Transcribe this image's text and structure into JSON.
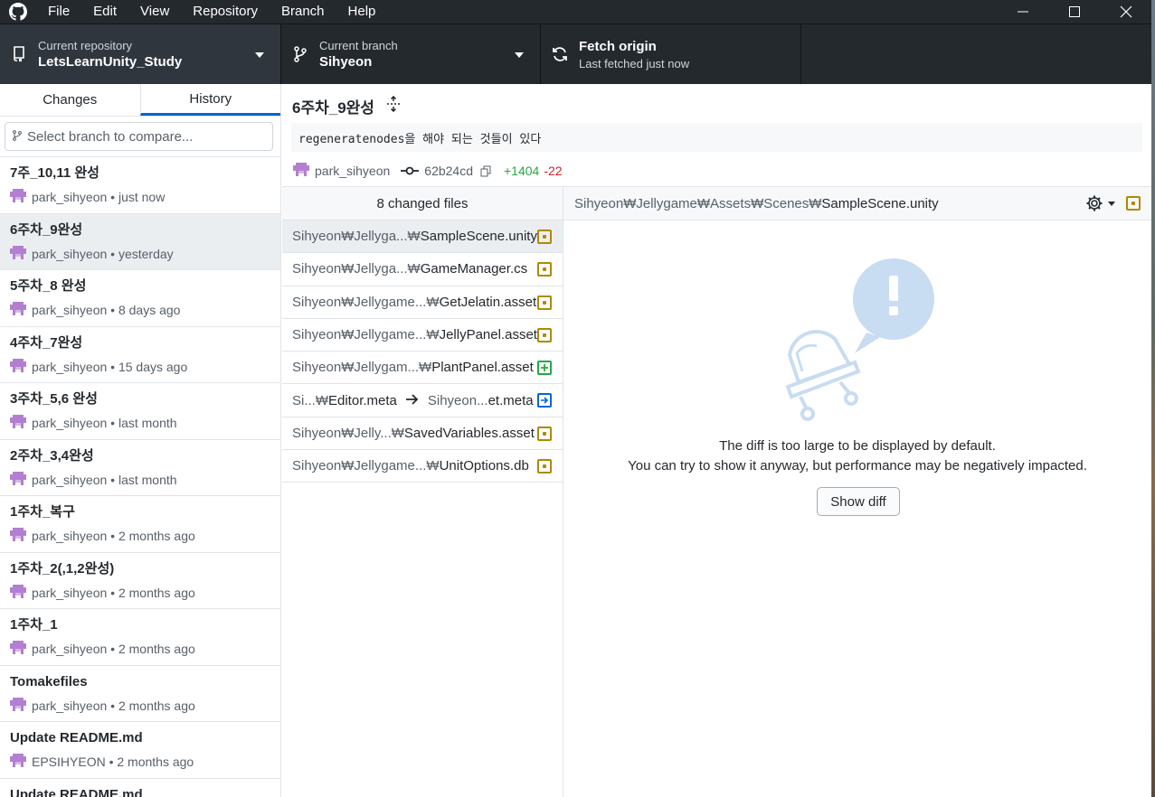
{
  "menu": [
    "File",
    "Edit",
    "View",
    "Repository",
    "Branch",
    "Help"
  ],
  "toolbar": {
    "repo_label": "Current repository",
    "repo_value": "LetsLearnUnity_Study",
    "branch_label": "Current branch",
    "branch_value": "Sihyeon",
    "fetch_title": "Fetch origin",
    "fetch_sub": "Last fetched just now"
  },
  "tabs": {
    "changes": "Changes",
    "history": "History"
  },
  "branch_filter": {
    "placeholder": "Select branch to compare..."
  },
  "commits": [
    {
      "title": "7주_10,11 완성",
      "meta": "park_sihyeon • just now"
    },
    {
      "title": "6주차_9완성",
      "meta": "park_sihyeon • yesterday"
    },
    {
      "title": "5주차_8 완성",
      "meta": "park_sihyeon • 8 days ago"
    },
    {
      "title": "4주차_7완성",
      "meta": "park_sihyeon • 15 days ago"
    },
    {
      "title": "3주차_5,6 완성",
      "meta": "park_sihyeon • last month"
    },
    {
      "title": "2주차_3,4완성",
      "meta": "park_sihyeon • last month"
    },
    {
      "title": "1주차_복구",
      "meta": "park_sihyeon • 2 months ago"
    },
    {
      "title": "1주차_2(,1,2완성)",
      "meta": "park_sihyeon • 2 months ago"
    },
    {
      "title": "1주차_1",
      "meta": "park_sihyeon • 2 months ago"
    },
    {
      "title": "Tomakefiles",
      "meta": "park_sihyeon • 2 months ago"
    },
    {
      "title": "Update README.md",
      "meta": "EPSIHYEON • 2 months ago"
    },
    {
      "title": "Update README.md",
      "meta": ""
    }
  ],
  "summary": {
    "title": "6주차_9완성",
    "description": "regeneratenodes을 해야 되는 것들이 있다",
    "author": "park_sihyeon",
    "sha": "62b24cd",
    "additions": "+1404",
    "deletions": "-22"
  },
  "files": {
    "header": "8 changed files",
    "items": [
      {
        "dir": "Sihyeon₩Jellyga...₩",
        "name": "SampleScene.unity",
        "status": "modified"
      },
      {
        "dir": "Sihyeon₩Jellyga...₩",
        "name": "GameManager.cs",
        "status": "modified"
      },
      {
        "dir": "Sihyeon₩Jellygame...₩",
        "name": "GetJelatin.asset",
        "status": "modified"
      },
      {
        "dir": "Sihyeon₩Jellygame...₩",
        "name": "JellyPanel.asset",
        "status": "modified"
      },
      {
        "dir": "Sihyeon₩Jellygam...₩",
        "name": "PlantPanel.asset",
        "status": "added"
      },
      {
        "dir": "Si...₩",
        "name": "Editor.meta",
        "status": "renamed",
        "to_dir": "Sihyeon...",
        "to_name": "et.meta"
      },
      {
        "dir": "Sihyeon₩Jelly...₩",
        "name": "SavedVariables.asset",
        "status": "modified"
      },
      {
        "dir": "Sihyeon₩Jellygame...₩",
        "name": "UnitOptions.db",
        "status": "modified"
      }
    ]
  },
  "diff": {
    "path_dir": "Sihyeon₩Jellygame₩Assets₩Scenes₩",
    "path_file": "SampleScene.unity",
    "message_line1": "The diff is too large to be displayed by default.",
    "message_line2": "You can try to show it anyway, but performance may be negatively impacted.",
    "show_button": "Show diff"
  },
  "icons": {
    "app": "github-logo-icon",
    "minimize": "minimize-icon",
    "maximize": "maximize-icon",
    "close": "close-icon",
    "repo": "repo-icon",
    "branch": "git-branch-icon",
    "fetch": "sync-icon",
    "search": "branch-search-icon",
    "commit": "git-commit-icon",
    "copy": "copy-icon",
    "gear": "gear-icon",
    "expand": "expand-icon"
  },
  "colors": {
    "accent": "#0366d6",
    "added": "#28a745",
    "deleted": "#cb2431",
    "modified": "#b08800",
    "chrome": "#24292e"
  }
}
